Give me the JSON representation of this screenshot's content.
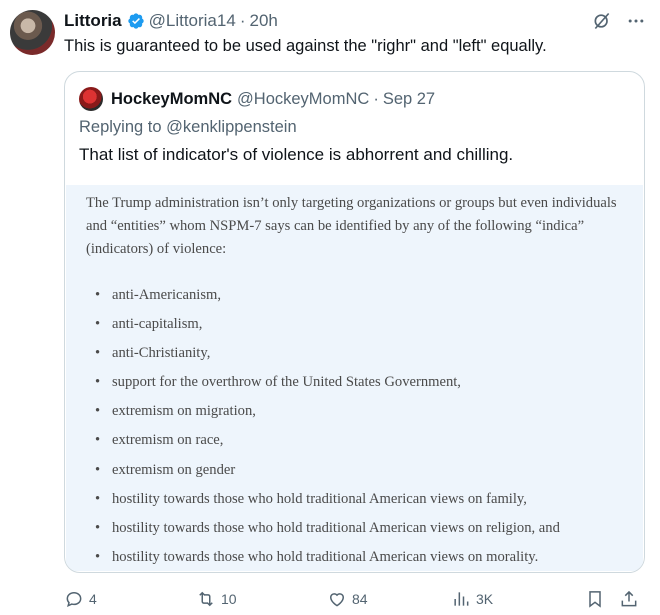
{
  "post": {
    "author_name": "Littoria",
    "handle": "@Littoria14",
    "separator": "·",
    "time": "20h",
    "text": "This is guaranteed to be used against the \"righr\" and \"left\" equally."
  },
  "quote": {
    "author_name": "HockeyMomNC",
    "handle": "@HockeyMomNC",
    "separator": "·",
    "time": "Sep 27",
    "replying_prefix": "Replying to ",
    "replying_to": "@kenklippenstein",
    "text": "That list of indicator's of violence is abhorrent and chilling.",
    "document": {
      "intro": "The Trump administration isn’t only targeting organizations or groups but even individuals and “entities” whom NSPM-7 says can be identified by any of the following “indica” (indicators) of violence:",
      "items": [
        "anti-Americanism,",
        "anti-capitalism,",
        "anti-Christianity,",
        "support for the overthrow of the United States Government,",
        "extremism on migration,",
        "extremism on race,",
        "extremism on gender",
        "hostility towards those who hold traditional American views on family,",
        "hostility towards those who hold traditional American views on religion, and",
        "hostility towards those who hold traditional American views on morality."
      ]
    }
  },
  "actions": {
    "replies": "4",
    "reposts": "10",
    "likes": "84",
    "views": "3K"
  },
  "icons": {
    "verified": "verified-badge-icon",
    "grok": "grok-icon",
    "more": "more-icon",
    "reply": "reply-icon",
    "repost": "repost-icon",
    "like": "heart-icon",
    "views": "views-icon",
    "bookmark": "bookmark-icon",
    "share": "share-icon"
  },
  "colors": {
    "verified": "#1d9bf0",
    "text": "#0f1419",
    "secondary": "#536471",
    "document_bg": "#eef5fc"
  }
}
